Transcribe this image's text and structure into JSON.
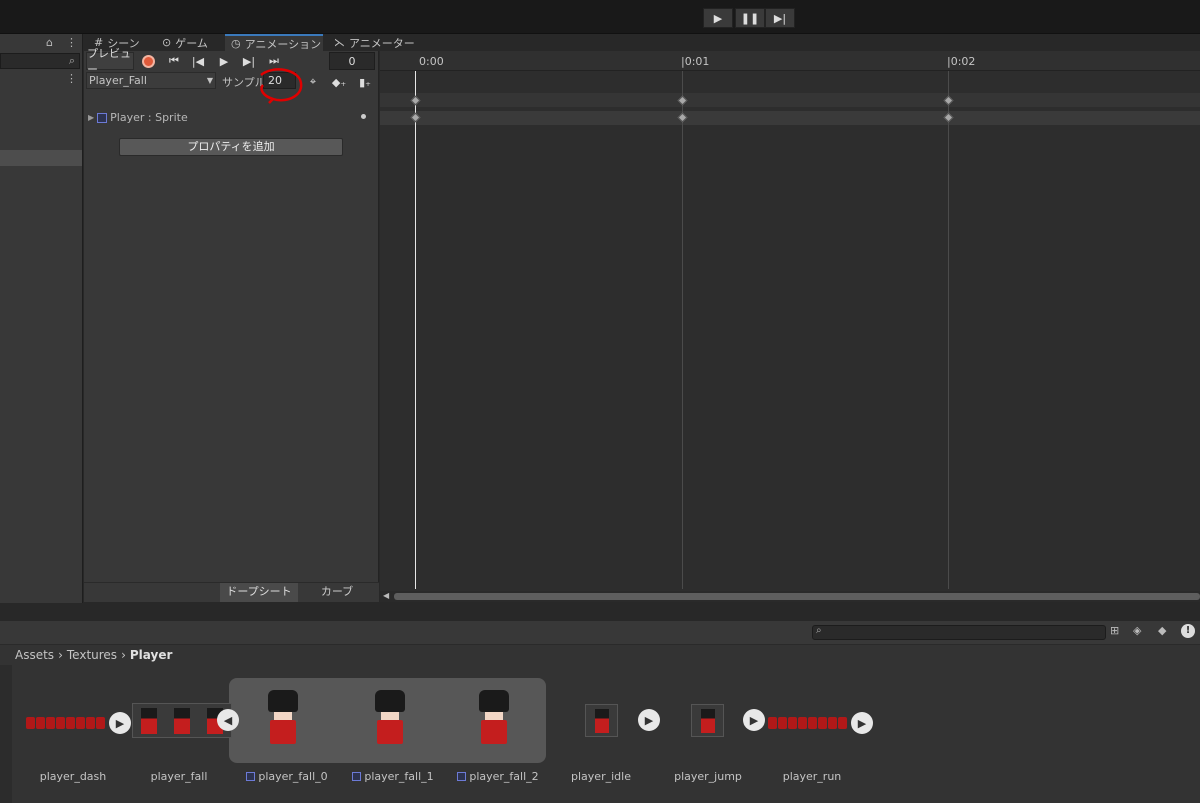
{
  "playbar": {
    "play": "▶",
    "pause": "❚❚",
    "step": "▶|"
  },
  "tabs": [
    {
      "icon": "#",
      "label": "シーン"
    },
    {
      "icon": "⊙",
      "label": "ゲーム"
    },
    {
      "icon": "◷",
      "label": "アニメーション"
    },
    {
      "icon": "⋋",
      "label": "アニメーター"
    }
  ],
  "controls": {
    "preview_label": "プレビュー",
    "frame_value": "0",
    "clip_name": "Player_Fall",
    "samples_label": "サンプル",
    "samples_value": "20",
    "property_name": "Player : Sprite",
    "add_property": "プロパティを追加",
    "dopesheet": "ドープシート",
    "curves": "カーブ"
  },
  "timeline": {
    "ticks": [
      "0:00",
      "|0:01",
      "|0:02"
    ]
  },
  "project": {
    "breadcrumb": [
      "Assets",
      "Textures",
      "Player"
    ],
    "assets": [
      {
        "name": "player_dash"
      },
      {
        "name": "player_fall"
      },
      {
        "name": "player_fall_0"
      },
      {
        "name": "player_fall_1"
      },
      {
        "name": "player_fall_2"
      },
      {
        "name": "player_idle"
      },
      {
        "name": "player_jump"
      },
      {
        "name": "player_run"
      }
    ]
  },
  "colors": {
    "accent": "#3a79bb",
    "record": "#e05a3a",
    "annotation": "#e00000",
    "sprite_red": "#c41e1e"
  }
}
